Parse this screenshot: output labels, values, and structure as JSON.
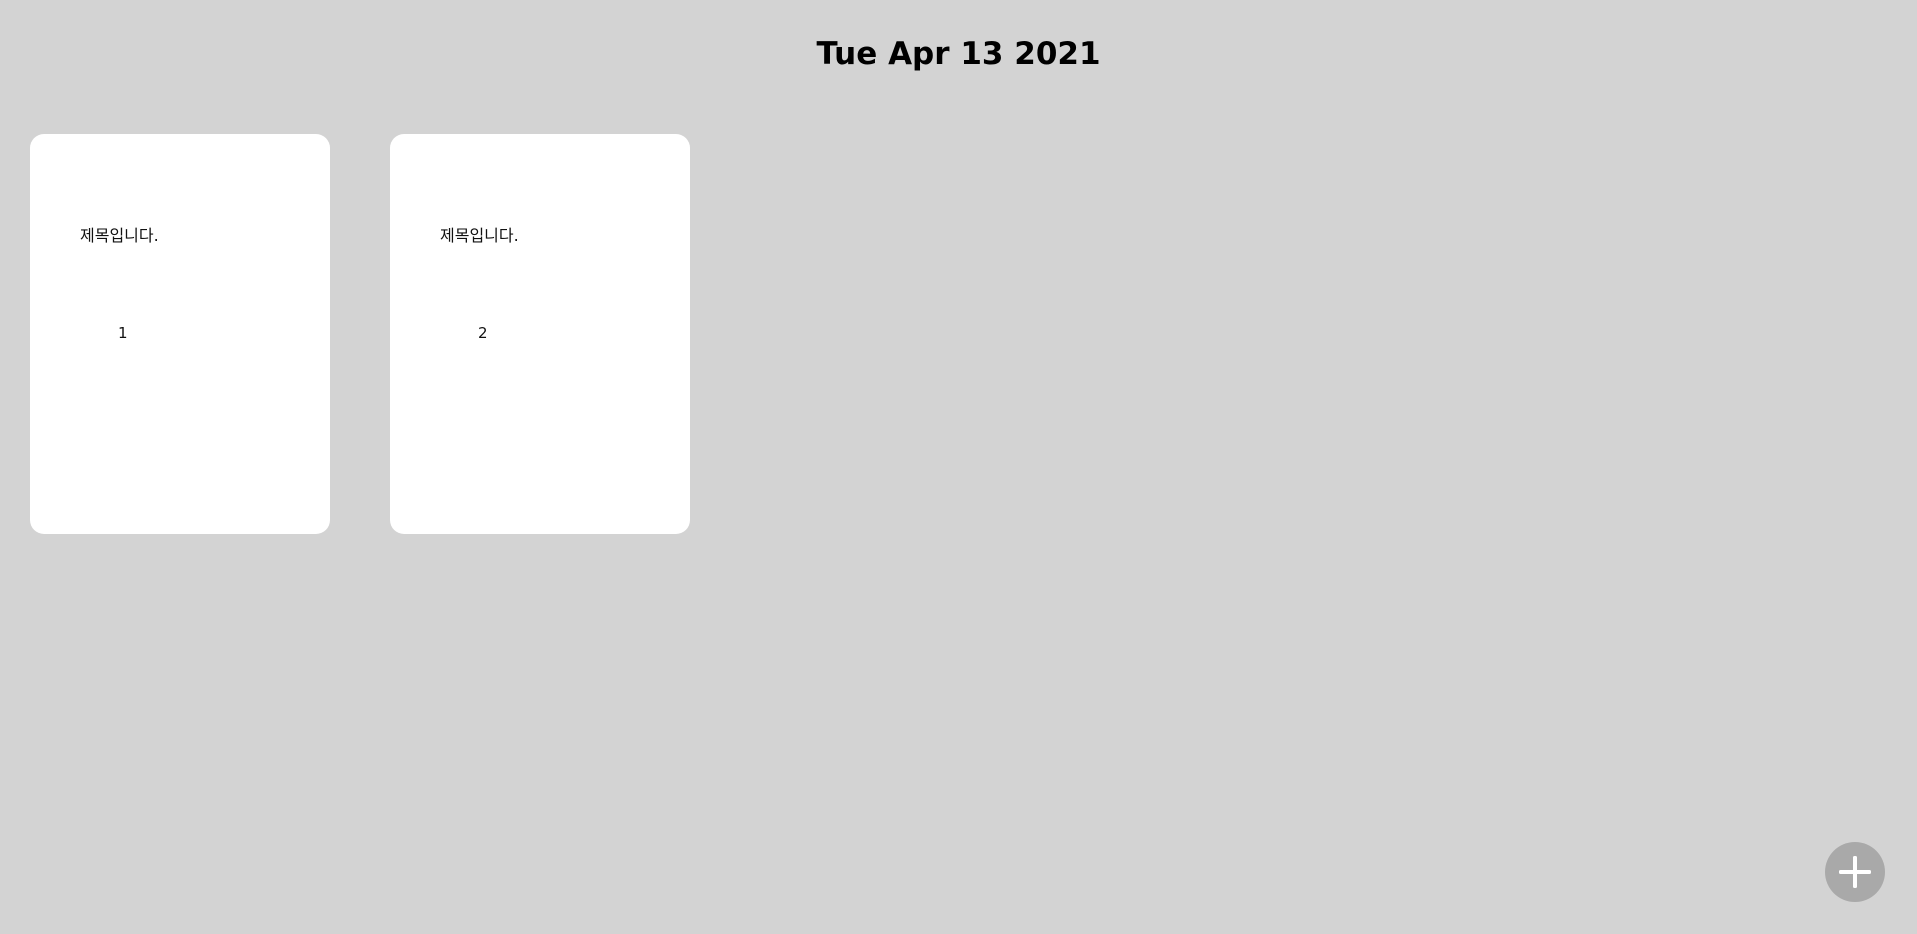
{
  "header": {
    "date": "Tue Apr 13 2021"
  },
  "cards": [
    {
      "title": "제목입니다.",
      "number": "1"
    },
    {
      "title": "제목입니다.",
      "number": "2"
    }
  ],
  "fab": {
    "icon": "plus-icon",
    "color": "#a9a9a9"
  },
  "colors": {
    "background": "#d3d3d3",
    "card": "#ffffff"
  }
}
